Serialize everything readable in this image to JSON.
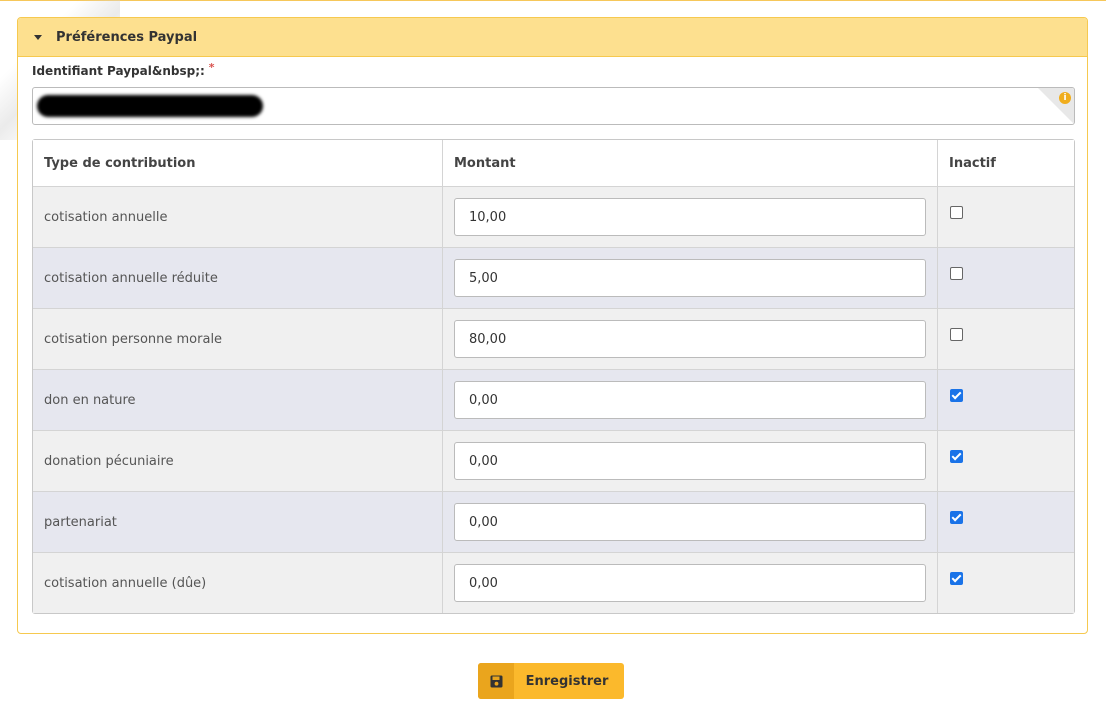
{
  "panel": {
    "title": "Préférences Paypal"
  },
  "paypal_id": {
    "label": "Identifiant Paypal&nbsp;:",
    "required_mark": "*",
    "value": "",
    "info_icon": "i"
  },
  "table": {
    "headers": {
      "type": "Type de contribution",
      "amount": "Montant",
      "inactive": "Inactif"
    },
    "rows": [
      {
        "type": "cotisation annuelle",
        "amount": "10,00",
        "inactive": false
      },
      {
        "type": "cotisation annuelle réduite",
        "amount": "5,00",
        "inactive": false
      },
      {
        "type": "cotisation personne morale",
        "amount": "80,00",
        "inactive": false
      },
      {
        "type": "don en nature",
        "amount": "0,00",
        "inactive": true
      },
      {
        "type": "donation pécuniaire",
        "amount": "0,00",
        "inactive": true
      },
      {
        "type": "partenariat",
        "amount": "0,00",
        "inactive": true
      },
      {
        "type": "cotisation annuelle (dûe)",
        "amount": "0,00",
        "inactive": true
      }
    ]
  },
  "actions": {
    "save_label": "Enregistrer"
  },
  "colors": {
    "header_bg": "#fde08f",
    "border_accent": "#f6c94f",
    "button_bg": "#fbb92c",
    "checkbox_checked": "#1a73e8"
  },
  "icons": {
    "collapse": "caret-down-icon",
    "info": "info-icon",
    "save": "floppy-disk-icon"
  }
}
